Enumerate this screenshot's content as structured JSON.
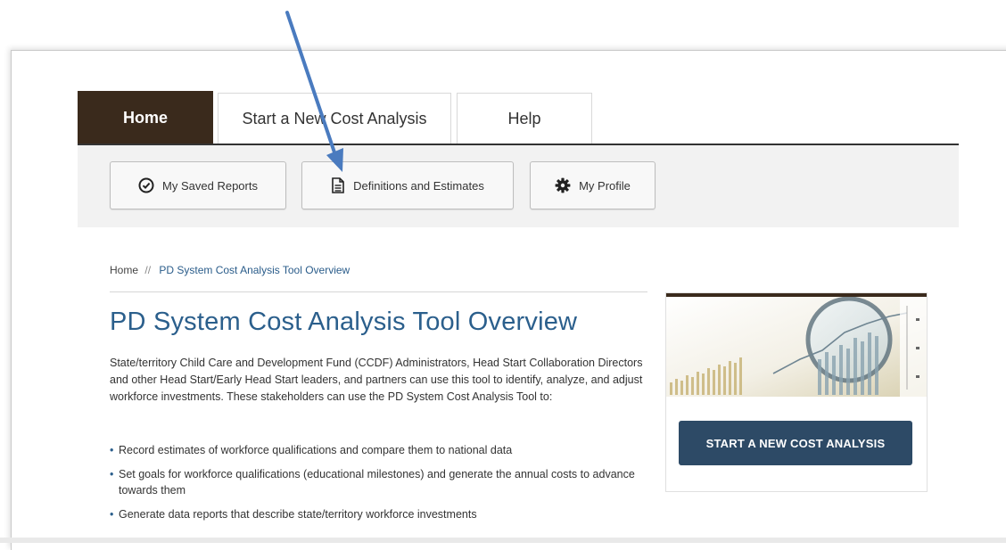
{
  "tabs": [
    {
      "label": "Home",
      "active": true
    },
    {
      "label": "Start a New Cost Analysis",
      "active": false
    },
    {
      "label": "Help",
      "active": false
    }
  ],
  "toolbar": {
    "saved_reports": {
      "label": "My Saved Reports",
      "icon": "check-circle-icon"
    },
    "definitions": {
      "label": "Definitions and Estimates",
      "icon": "document-icon"
    },
    "profile": {
      "label": "My Profile",
      "icon": "gear-icon"
    }
  },
  "breadcrumb": {
    "home": "Home",
    "separator": "//",
    "current": "PD System Cost Analysis Tool Overview"
  },
  "main": {
    "title": "PD System Cost Analysis Tool Overview",
    "intro": "State/territory Child Care and Development Fund (CCDF) Administrators, Head Start Collaboration Directors and other Head Start/Early Head Start leaders, and partners can use this tool to identify, analyze, and adjust workforce investments. These stakeholders can use the PD System Cost Analysis Tool to:",
    "bullets": [
      "Record estimates of workforce qualifications and compare them to national data",
      "Set goals for workforce qualifications (educational milestones) and generate the annual costs to advance towards them",
      "Generate data reports that describe state/territory workforce investments"
    ]
  },
  "side": {
    "image": "chart-magnifier-image",
    "cta_label": "START A NEW COST ANALYSIS"
  },
  "annotation": {
    "icon": "arrow-pointer-icon",
    "color": "#4a7bbf"
  },
  "colors": {
    "tab_active_bg": "#3a2a1c",
    "title_blue": "#2b5f8c",
    "cta_bg": "#2d4a66"
  }
}
